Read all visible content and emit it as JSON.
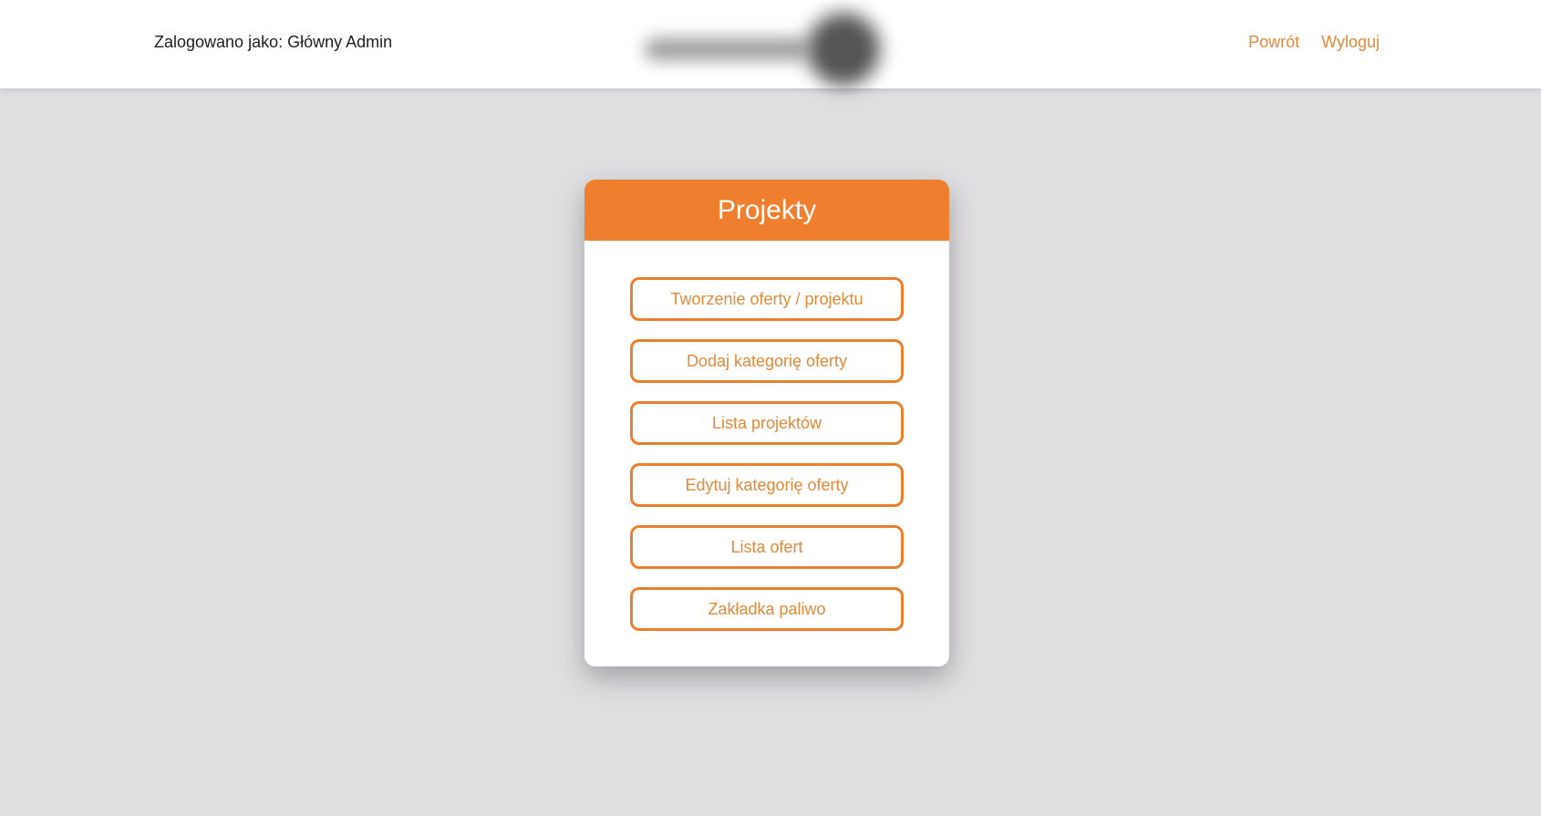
{
  "header": {
    "user_label": "Zalogowano jako: Główny Admin",
    "logo": "blurred-company-logo",
    "nav": {
      "back_label": "Powrót",
      "logout_label": "Wyloguj"
    }
  },
  "card": {
    "title": "Projekty",
    "buttons": [
      {
        "label": "Tworzenie oferty / projektu"
      },
      {
        "label": "Dodaj kategorię oferty"
      },
      {
        "label": "Lista projektów"
      },
      {
        "label": "Edytuj kategorię oferty"
      },
      {
        "label": "Lista ofert"
      },
      {
        "label": "Zakładka paliwo"
      }
    ]
  },
  "colors": {
    "accent": "#ef7f2e",
    "link": "#e08a3c",
    "background": "#dfdee1"
  }
}
